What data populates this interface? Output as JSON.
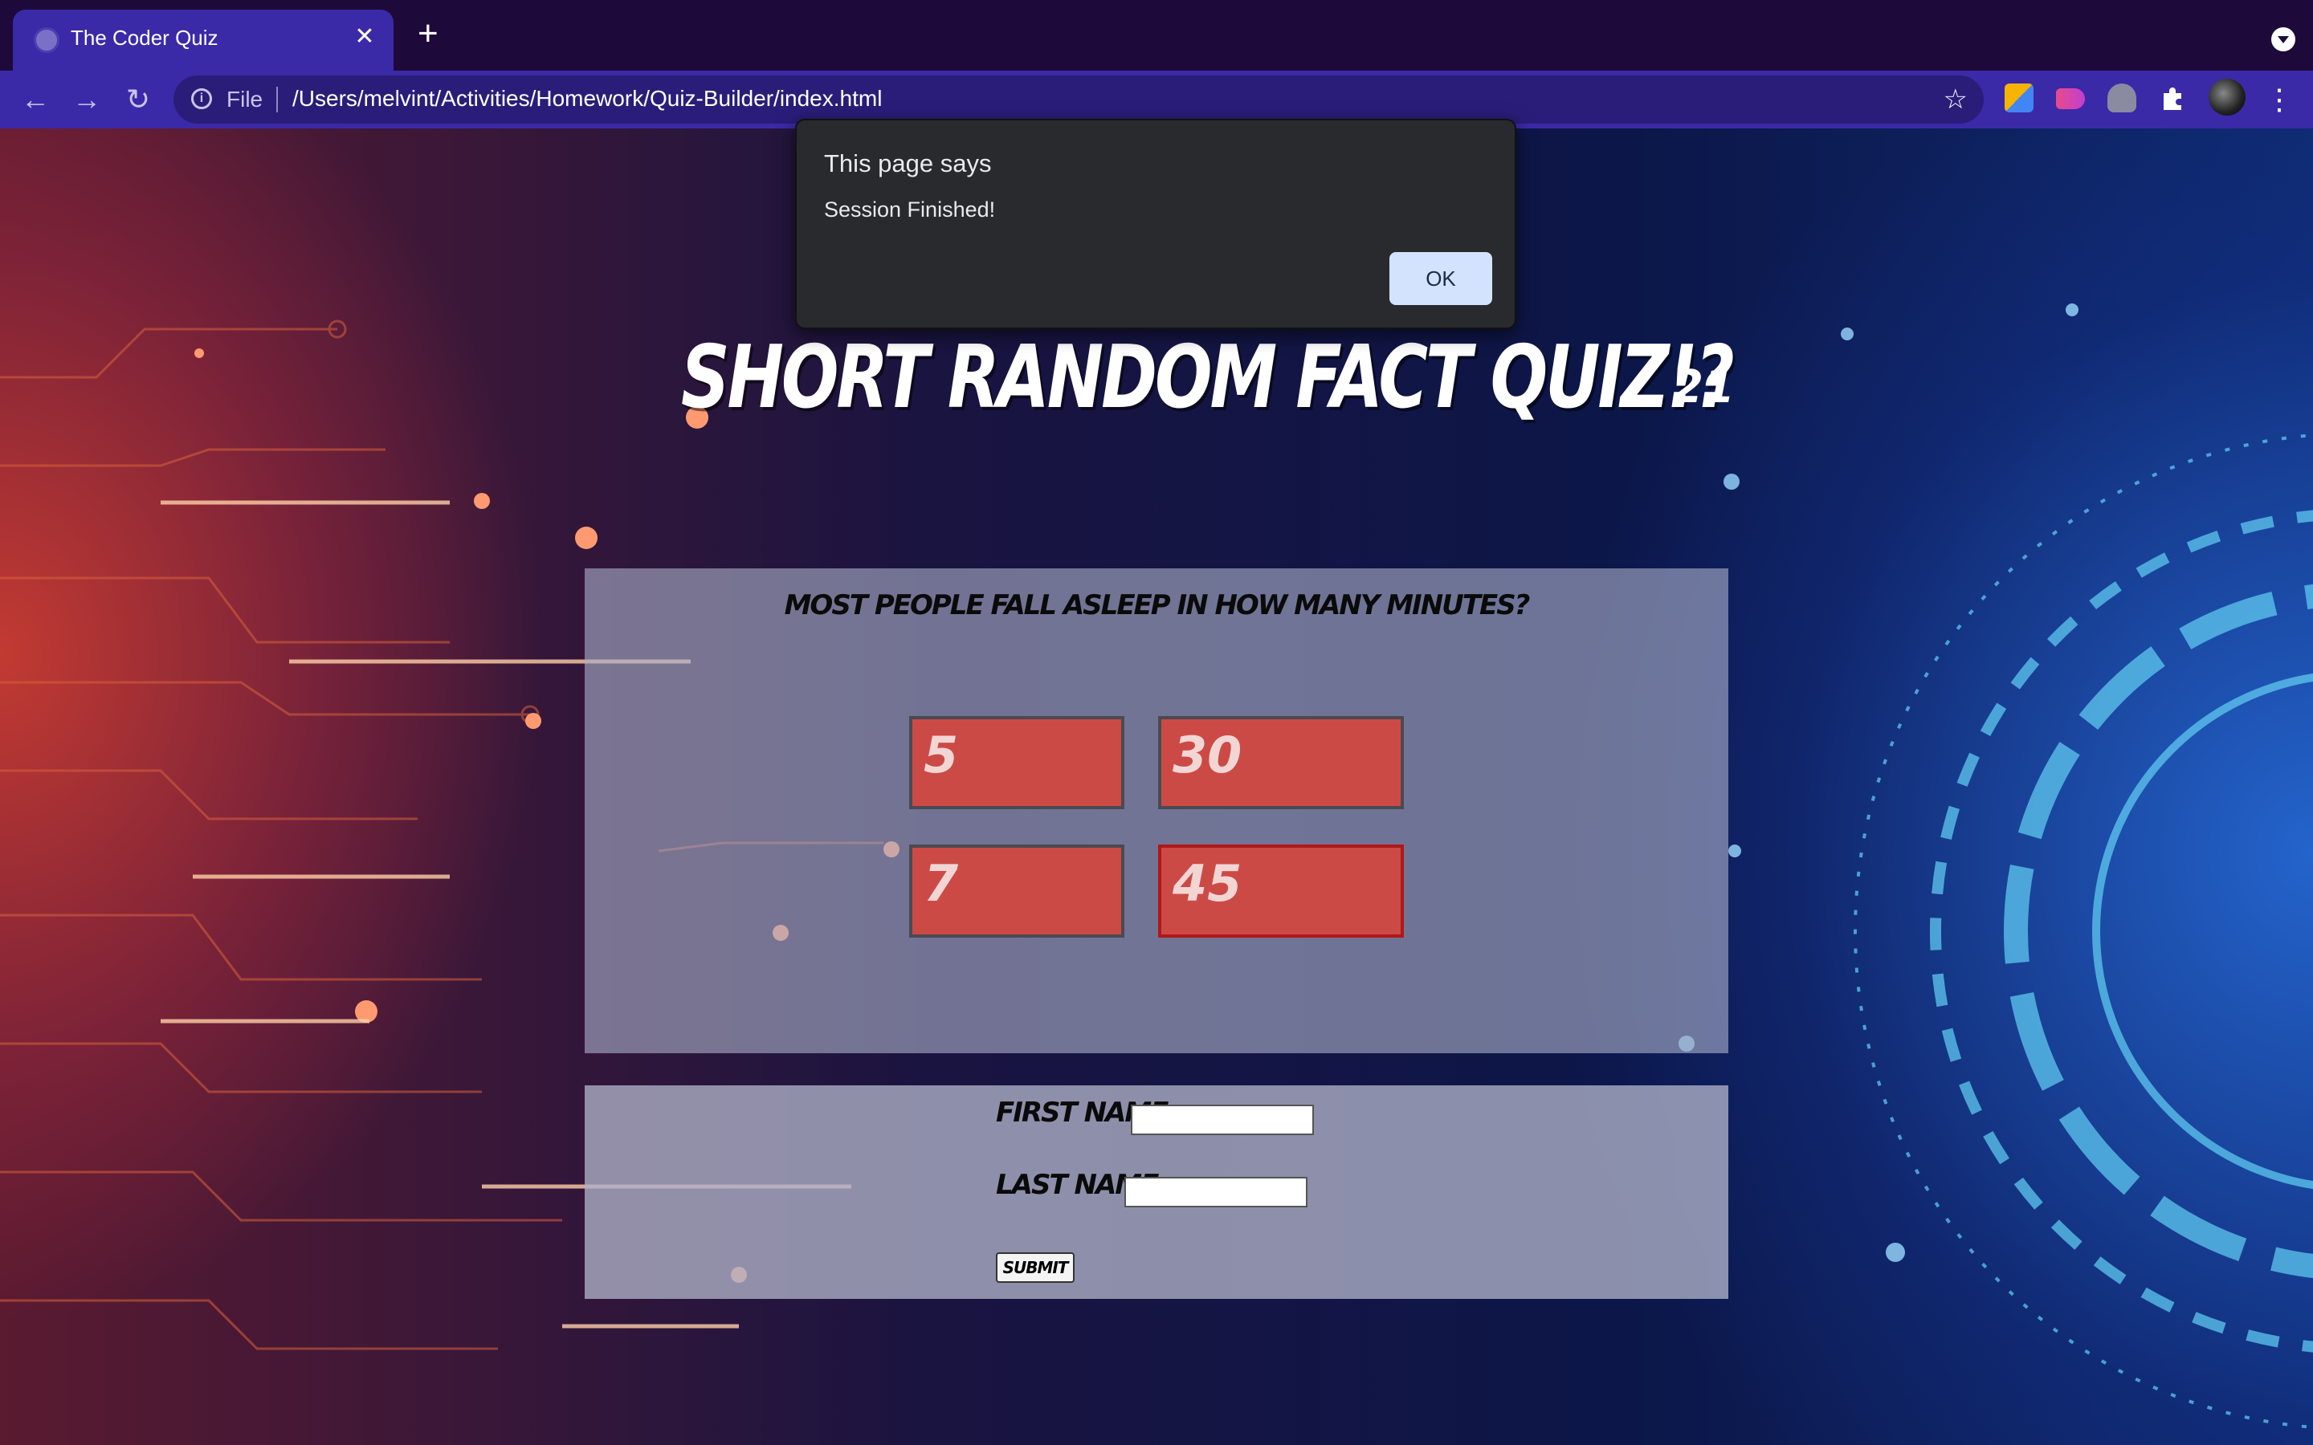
{
  "browser": {
    "tab_title": "The Coder Quiz",
    "tab_close": "✕",
    "new_tab": "+",
    "back": "←",
    "forward": "→",
    "reload": "↻",
    "info": "i",
    "scheme": "File",
    "url": "/Users/melvint/Activities/Homework/Quiz-Builder/index.html",
    "bookmark": "☆",
    "menu": "⋮",
    "extensions": [
      "colorpicker-icon",
      "video-icon",
      "fox-icon",
      "puzzle-icon",
      "profile-avatar"
    ]
  },
  "alert": {
    "title": "This page says",
    "message": "Session Finished!",
    "ok_label": "OK"
  },
  "quiz": {
    "title": "Short Random Fact Quiz!?",
    "timer": "21",
    "question": "Most people fall asleep in how many minutes?",
    "answers": [
      "5",
      "30",
      "7",
      "45"
    ]
  },
  "form": {
    "first_name_label": "First Name:",
    "last_name_label": "Last Name:",
    "first_name_value": "",
    "last_name_value": "",
    "submit_label": "Submit"
  },
  "colors": {
    "accent": "#3a2aa8",
    "answer_bg": "#cc4a46",
    "alert_bg": "#292a2d",
    "ok_button": "#d3e3fd"
  }
}
